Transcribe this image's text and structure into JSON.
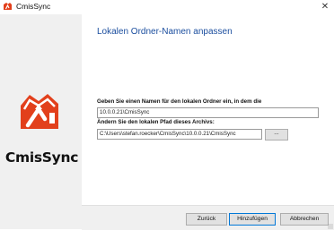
{
  "window": {
    "title": "CmisSync"
  },
  "sidebar": {
    "logo_text": "CmisSync"
  },
  "page": {
    "title": "Lokalen Ordner-Namen anpassen",
    "name_label": "Geben Sie einen Namen für den lokalen Ordner ein, in dem die",
    "name_value": "10.0.0.21\\CmisSync",
    "path_label": "Ändern Sie den lokalen Pfad dieses Archivs:",
    "path_value": "C:\\Users\\stefan.roecker\\CmisSync\\10.0.0.21\\CmisSync",
    "browse_label": "..."
  },
  "buttons": {
    "back": "Zurück",
    "add": "Hinzufügen",
    "cancel": "Abbrechen"
  },
  "colors": {
    "brand": "#e2401c",
    "title_blue": "#1a4d9e"
  }
}
